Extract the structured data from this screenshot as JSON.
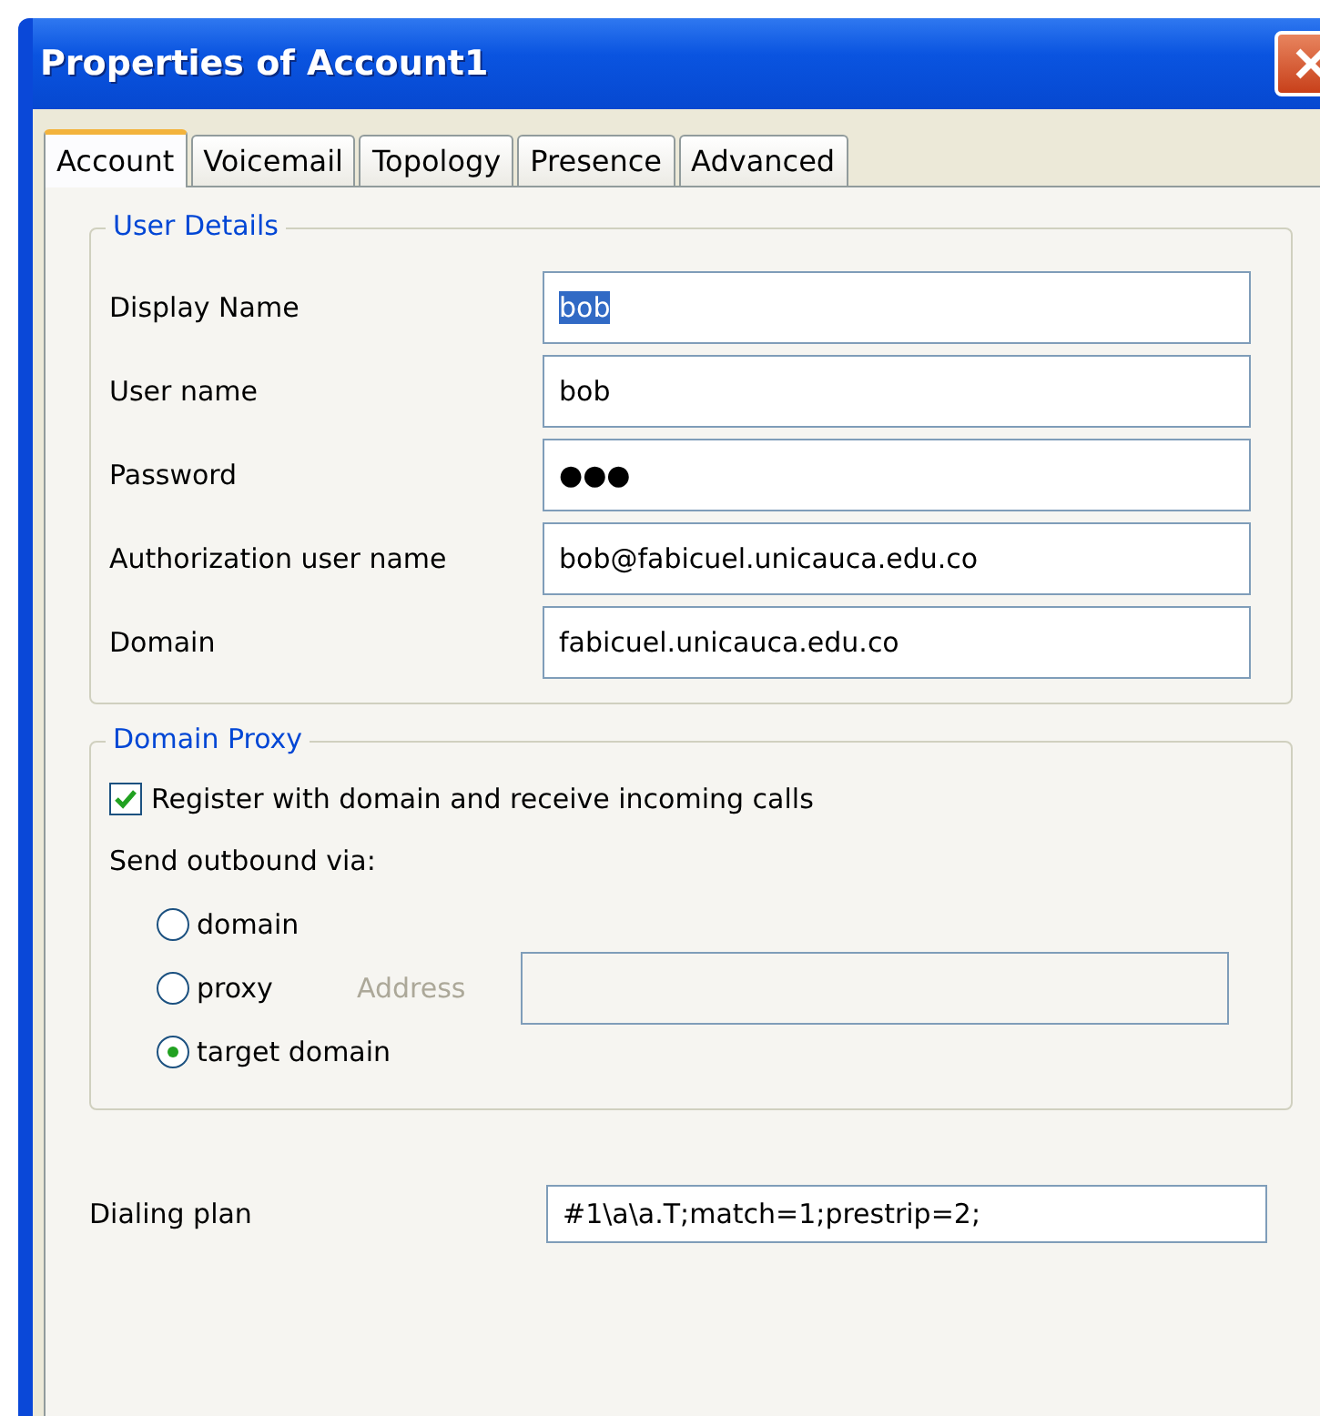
{
  "window": {
    "title": "Properties of Account1"
  },
  "tabs": [
    {
      "label": "Account",
      "selected": true
    },
    {
      "label": "Voicemail",
      "selected": false
    },
    {
      "label": "Topology",
      "selected": false
    },
    {
      "label": "Presence",
      "selected": false
    },
    {
      "label": "Advanced",
      "selected": false
    }
  ],
  "user_details": {
    "title": "User Details",
    "fields": [
      {
        "label": "Display Name",
        "value": "bob",
        "highlighted": true
      },
      {
        "label": "User name",
        "value": "bob",
        "highlighted": false
      },
      {
        "label": "Password",
        "value": "●●●",
        "highlighted": false
      },
      {
        "label": "Authorization user name",
        "value": "bob@fabicuel.unicauca.edu.co",
        "highlighted": false
      },
      {
        "label": "Domain",
        "value": "fabicuel.unicauca.edu.co",
        "highlighted": false
      }
    ]
  },
  "domain_proxy": {
    "title": "Domain Proxy",
    "register": {
      "label": "Register with domain and receive incoming calls",
      "checked": true
    },
    "send_label": "Send outbound via:",
    "options": [
      {
        "label": "domain",
        "selected": false
      },
      {
        "label": "proxy",
        "selected": false
      },
      {
        "label": "target domain",
        "selected": true
      }
    ],
    "address": {
      "label": "Address",
      "disabled": true
    }
  },
  "dialing_plan": {
    "label": "Dialing plan",
    "value": "#1\\a\\a.T;match=1;prestrip=2;"
  }
}
